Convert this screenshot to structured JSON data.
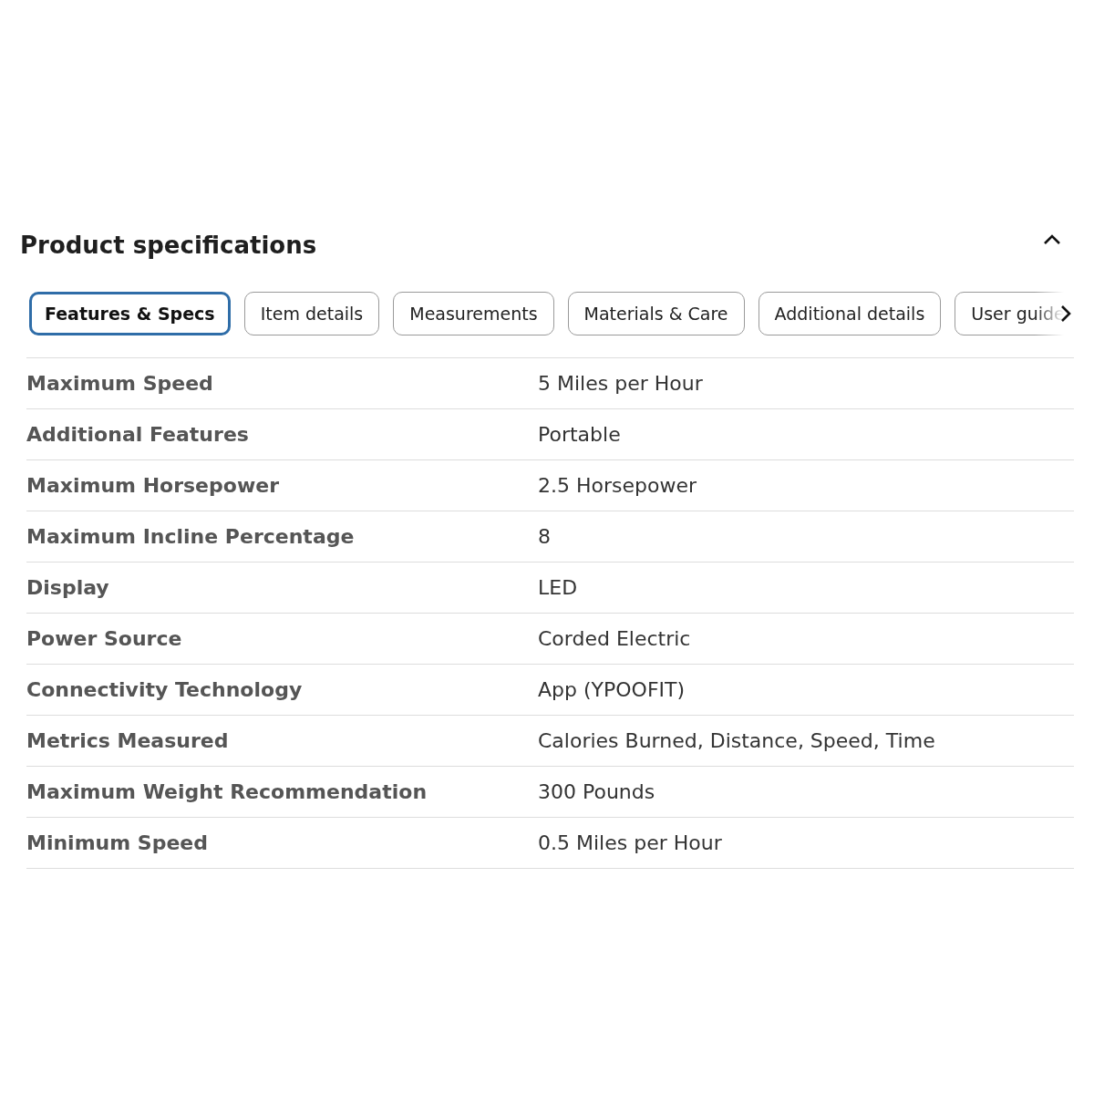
{
  "section": {
    "title": "Product specifications",
    "expanded": true
  },
  "tabs": [
    {
      "label": "Features & Specs",
      "selected": true
    },
    {
      "label": "Item details",
      "selected": false
    },
    {
      "label": "Measurements",
      "selected": false
    },
    {
      "label": "Materials & Care",
      "selected": false
    },
    {
      "label": "Additional details",
      "selected": false
    },
    {
      "label": "User guide",
      "selected": false
    }
  ],
  "specs": [
    {
      "name": "Maximum Speed",
      "value": "5 Miles per Hour"
    },
    {
      "name": "Additional Features",
      "value": "Portable"
    },
    {
      "name": "Maximum Horsepower",
      "value": "2.5 Horsepower"
    },
    {
      "name": "Maximum Incline Percentage",
      "value": "8"
    },
    {
      "name": "Display",
      "value": "LED"
    },
    {
      "name": "Power Source",
      "value": "Corded Electric"
    },
    {
      "name": "Connectivity Technology",
      "value": "App (YPOOFIT)"
    },
    {
      "name": "Metrics Measured",
      "value": "Calories Burned, Distance, Speed, Time"
    },
    {
      "name": "Maximum Weight Recommendation",
      "value": "300 Pounds"
    },
    {
      "name": "Minimum Speed",
      "value": "0.5 Miles per Hour"
    }
  ]
}
